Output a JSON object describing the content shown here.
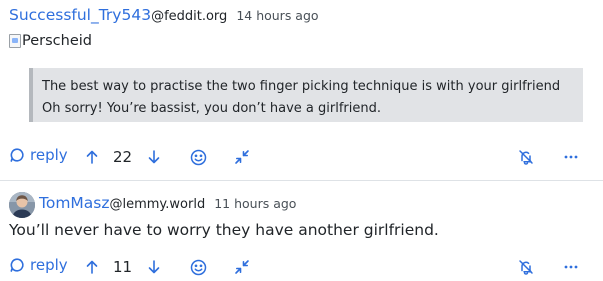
{
  "comments": [
    {
      "username": "Successful_Try543",
      "instance": "@feddit.org",
      "time": "14 hours ago",
      "image_alt": "Perscheid",
      "quote_lines": [
        "The best way to practise the two finger picking technique is with your girlfriend",
        "Oh sorry! You’re bassist, you don’t have a girlfriend."
      ],
      "reply_label": "reply",
      "score": "22"
    },
    {
      "username": "TomMasz",
      "instance": "@lemmy.world",
      "time": "11 hours ago",
      "body": "You’ll never have to worry they have another girlfriend.",
      "reply_label": "reply",
      "score": "11"
    }
  ],
  "colors": {
    "accent": "#2f6fdd",
    "quote_bg": "#e1e3e6",
    "quote_border": "#b4b8bd",
    "divider": "#dee2e6"
  },
  "icons": [
    "reply-icon",
    "upvote-icon",
    "downvote-icon",
    "smiley-icon",
    "collapse-icon",
    "mute-bell-icon",
    "more-icon"
  ]
}
